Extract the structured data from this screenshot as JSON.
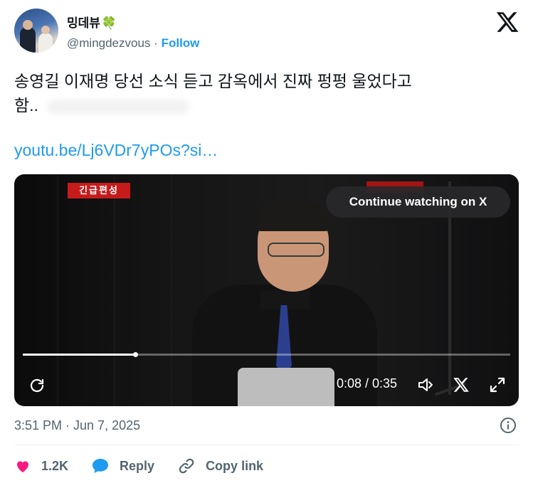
{
  "user": {
    "display_name": "밍데뷰",
    "emoji": "🍀",
    "handle": "@mingdezvous",
    "separator": "·",
    "follow_label": "Follow"
  },
  "tweet": {
    "text_line1": "송영길 이재명 당선 소식 듣고 감옥에서 진짜 펑펑 울었다고",
    "text_line2": "함..",
    "link": "youtu.be/Lj6VDr7yPOs?si…"
  },
  "video": {
    "badge": "긴급편성",
    "cta": "Continue watching on X",
    "time": "0:08 / 0:35",
    "progress": 0.23
  },
  "meta": {
    "timestamp": "3:51 PM · Jun 7, 2025"
  },
  "actions": {
    "likes": "1.2K",
    "reply_label": "Reply",
    "copy_label": "Copy link"
  },
  "colors": {
    "accent": "#1d9bf0",
    "like": "#f91880",
    "muted": "#536471"
  }
}
